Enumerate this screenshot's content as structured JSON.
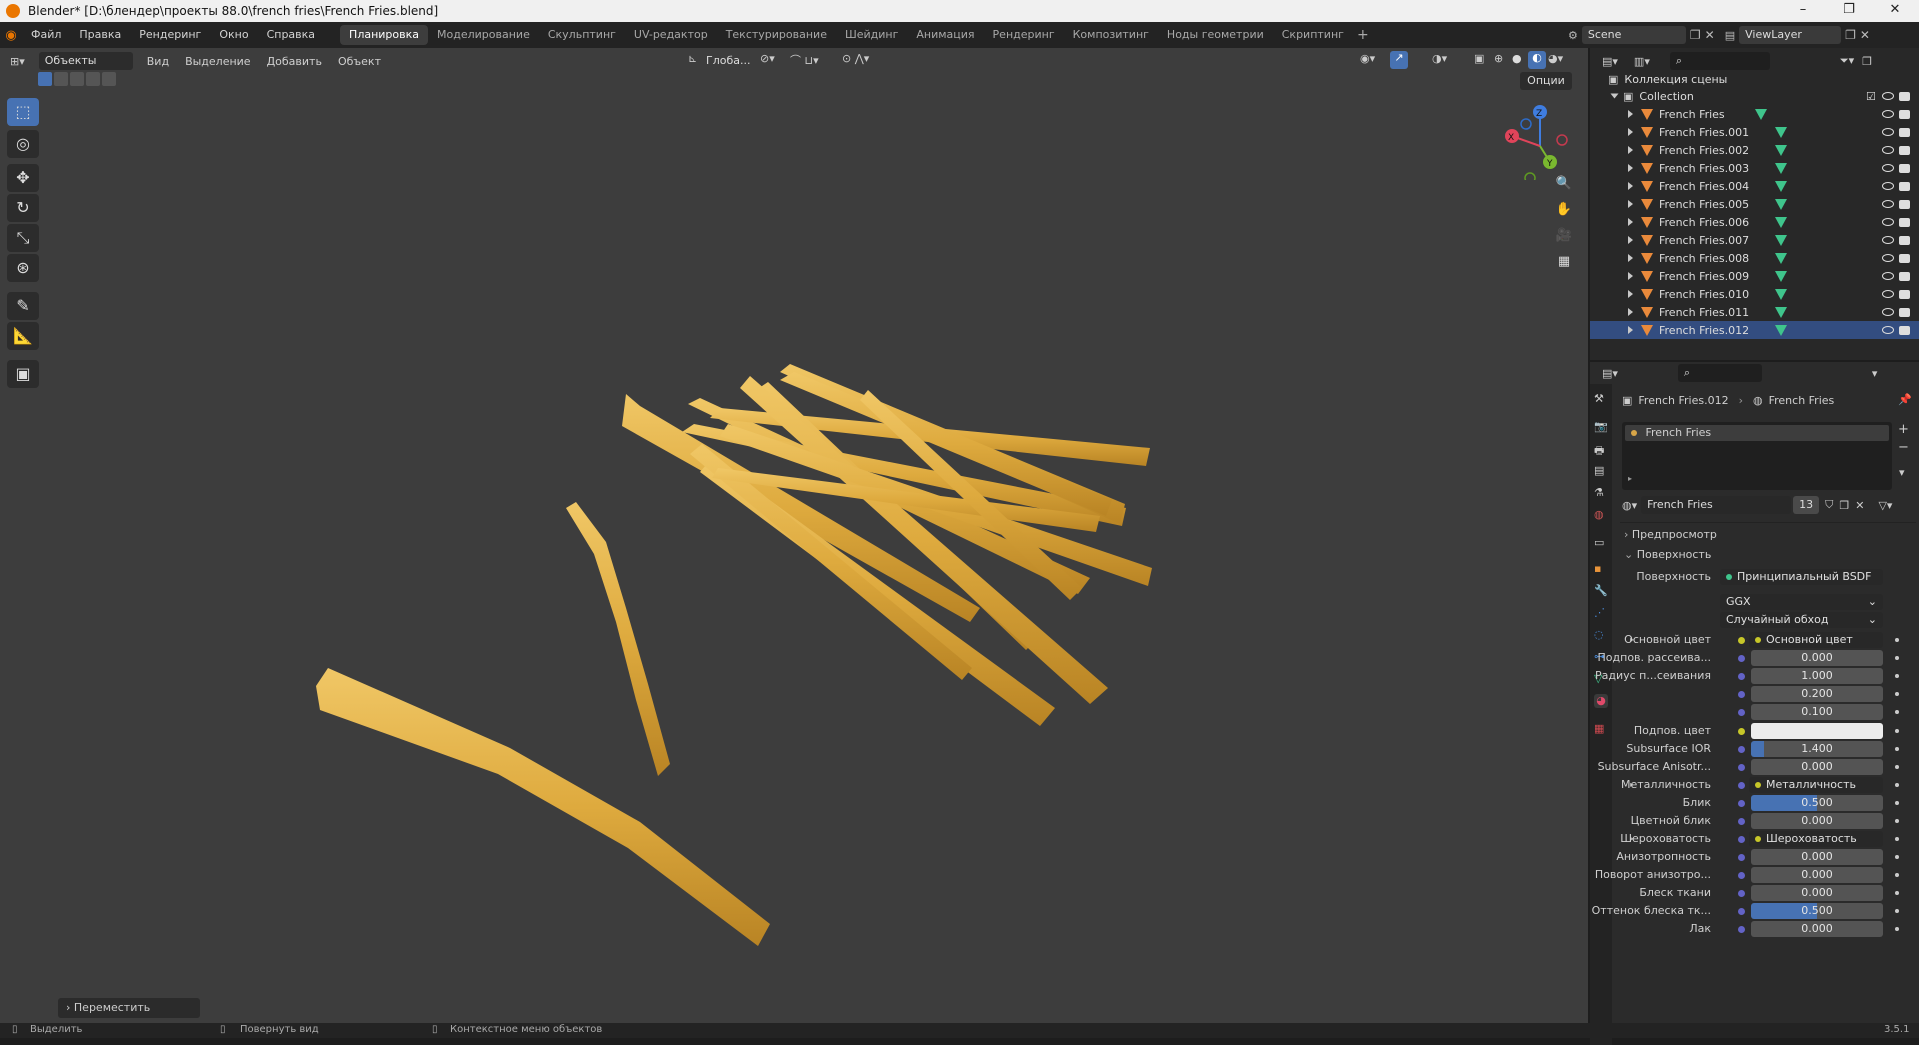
{
  "window": {
    "title": "Blender* [D:\\блендер\\проекты 88.0\\french fries\\French Fries.blend]"
  },
  "menu": [
    "Файл",
    "Правка",
    "Рендеринг",
    "Окно",
    "Справка"
  ],
  "workspaces": [
    "Планировка",
    "Моделирование",
    "Скульптинг",
    "UV-редактор",
    "Текстурирование",
    "Шейдинг",
    "Анимация",
    "Рендеринг",
    "Композитинг",
    "Ноды геометрии",
    "Скриптинг"
  ],
  "active_workspace": "Планировка",
  "scene": "Scene",
  "view_layer": "ViewLayer",
  "viewport": {
    "mode": "Объекты",
    "menus": [
      "Вид",
      "Выделение",
      "Добавить",
      "Объект"
    ],
    "orientation": "Глоба...",
    "options": "Опции",
    "last_operator": "Переместить"
  },
  "gizmo": {
    "z": "Z",
    "y": "Y",
    "x": "X"
  },
  "outliner": {
    "root": "Коллекция сцены",
    "collection": "Collection",
    "objects": [
      "French Fries",
      "French Fries.001",
      "French Fries.002",
      "French Fries.003",
      "French Fries.004",
      "French Fries.005",
      "French Fries.006",
      "French Fries.007",
      "French Fries.008",
      "French Fries.009",
      "French Fries.010",
      "French Fries.011",
      "French Fries.012"
    ],
    "selected": "French Fries.012"
  },
  "properties": {
    "breadcrumb_object": "French Fries.012",
    "breadcrumb_material": "French Fries",
    "slot_name": "French Fries",
    "material_name": "French Fries",
    "user_count": "13",
    "panel_preview": "Предпросмотр",
    "panel_surface": "Поверхность",
    "surface_label": "Поверхность",
    "surface_value": "Принципиальный BSDF",
    "distribution": "GGX",
    "subsurface_method": "Случайный обход",
    "rows": [
      {
        "label": "Основной цвет",
        "value": "Основной цвет",
        "kind": "link"
      },
      {
        "label": "Подпов. рассеива...",
        "value": "0.000",
        "kind": "num",
        "fill": 0
      },
      {
        "label": "Радиус п...сеивания",
        "value": "1.000",
        "kind": "num",
        "fill": 0
      },
      {
        "label": "",
        "value": "0.200",
        "kind": "num",
        "fill": 0
      },
      {
        "label": "",
        "value": "0.100",
        "kind": "num",
        "fill": 0
      },
      {
        "label": "Подпов. цвет",
        "value": "",
        "kind": "color"
      },
      {
        "label": "Subsurface IOR",
        "value": "1.400",
        "kind": "num",
        "fill": 0.1
      },
      {
        "label": "Subsurface Anisotr...",
        "value": "0.000",
        "kind": "num",
        "fill": 0
      },
      {
        "label": "Металличность",
        "value": "Металличность",
        "kind": "link"
      },
      {
        "label": "Блик",
        "value": "0.500",
        "kind": "num",
        "fill": 0.5
      },
      {
        "label": "Цветной блик",
        "value": "0.000",
        "kind": "num",
        "fill": 0
      },
      {
        "label": "Шероховатость",
        "value": "Шероховатость",
        "kind": "link"
      },
      {
        "label": "Анизотропность",
        "value": "0.000",
        "kind": "num",
        "fill": 0
      },
      {
        "label": "Поворот анизотро...",
        "value": "0.000",
        "kind": "num",
        "fill": 0
      },
      {
        "label": "Блеск ткани",
        "value": "0.000",
        "kind": "num",
        "fill": 0
      },
      {
        "label": "Оттенок блеска тк...",
        "value": "0.500",
        "kind": "num",
        "fill": 0.5
      },
      {
        "label": "Лак",
        "value": "0.000",
        "kind": "num",
        "fill": 0
      }
    ]
  },
  "statusbar": {
    "left": "Выделить",
    "middle": "Повернуть вид",
    "right": "Контекстное меню объектов",
    "version": "3.5.1"
  }
}
